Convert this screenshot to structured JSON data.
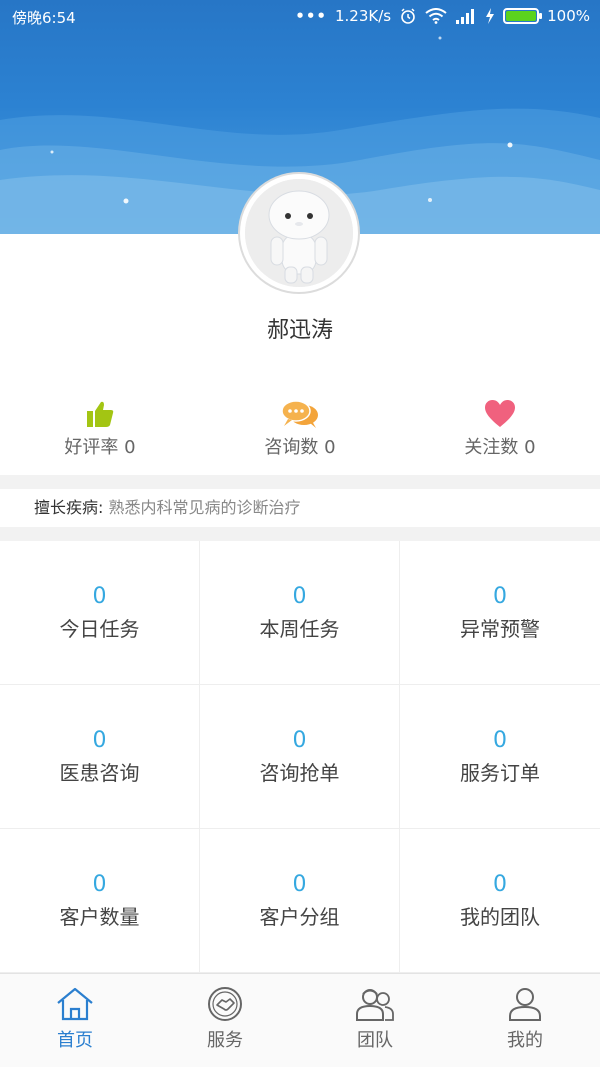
{
  "status_bar": {
    "time": "傍晚6:54",
    "dots": "•••",
    "net_speed": "1.23K/s",
    "battery_percent": "100%",
    "battery_color": "#5bd31d"
  },
  "profile": {
    "name": "郝迅涛",
    "banner_color": "#2b7fcf"
  },
  "stats": [
    {
      "label": "好评率 0",
      "icon": "thumbs-up-icon",
      "color": "#a3c513"
    },
    {
      "label": "咨询数 0",
      "icon": "chat-bubbles-icon",
      "color": "#f3a43a"
    },
    {
      "label": "关注数 0",
      "icon": "heart-icon",
      "color": "#f0617e"
    }
  ],
  "specialty": {
    "label": "擅长疾病:",
    "value": " 熟悉内科常见病的诊断治疗"
  },
  "grid": [
    {
      "value": "0",
      "label": "今日任务"
    },
    {
      "value": "0",
      "label": "本周任务"
    },
    {
      "value": "0",
      "label": "异常预警"
    },
    {
      "value": "0",
      "label": "医患咨询"
    },
    {
      "value": "0",
      "label": "咨询抢单"
    },
    {
      "value": "0",
      "label": "服务订单"
    },
    {
      "value": "0",
      "label": "客户数量"
    },
    {
      "value": "0",
      "label": "客户分组"
    },
    {
      "value": "0",
      "label": "我的团队"
    }
  ],
  "tabs": [
    {
      "label": "首页",
      "icon": "home-icon",
      "active": true
    },
    {
      "label": "服务",
      "icon": "handshake-icon",
      "active": false
    },
    {
      "label": "团队",
      "icon": "team-icon",
      "active": false
    },
    {
      "label": "我的",
      "icon": "user-icon",
      "active": false
    }
  ],
  "colors": {
    "accent": "#2b7fcf",
    "grid_number": "#35a8e0"
  }
}
